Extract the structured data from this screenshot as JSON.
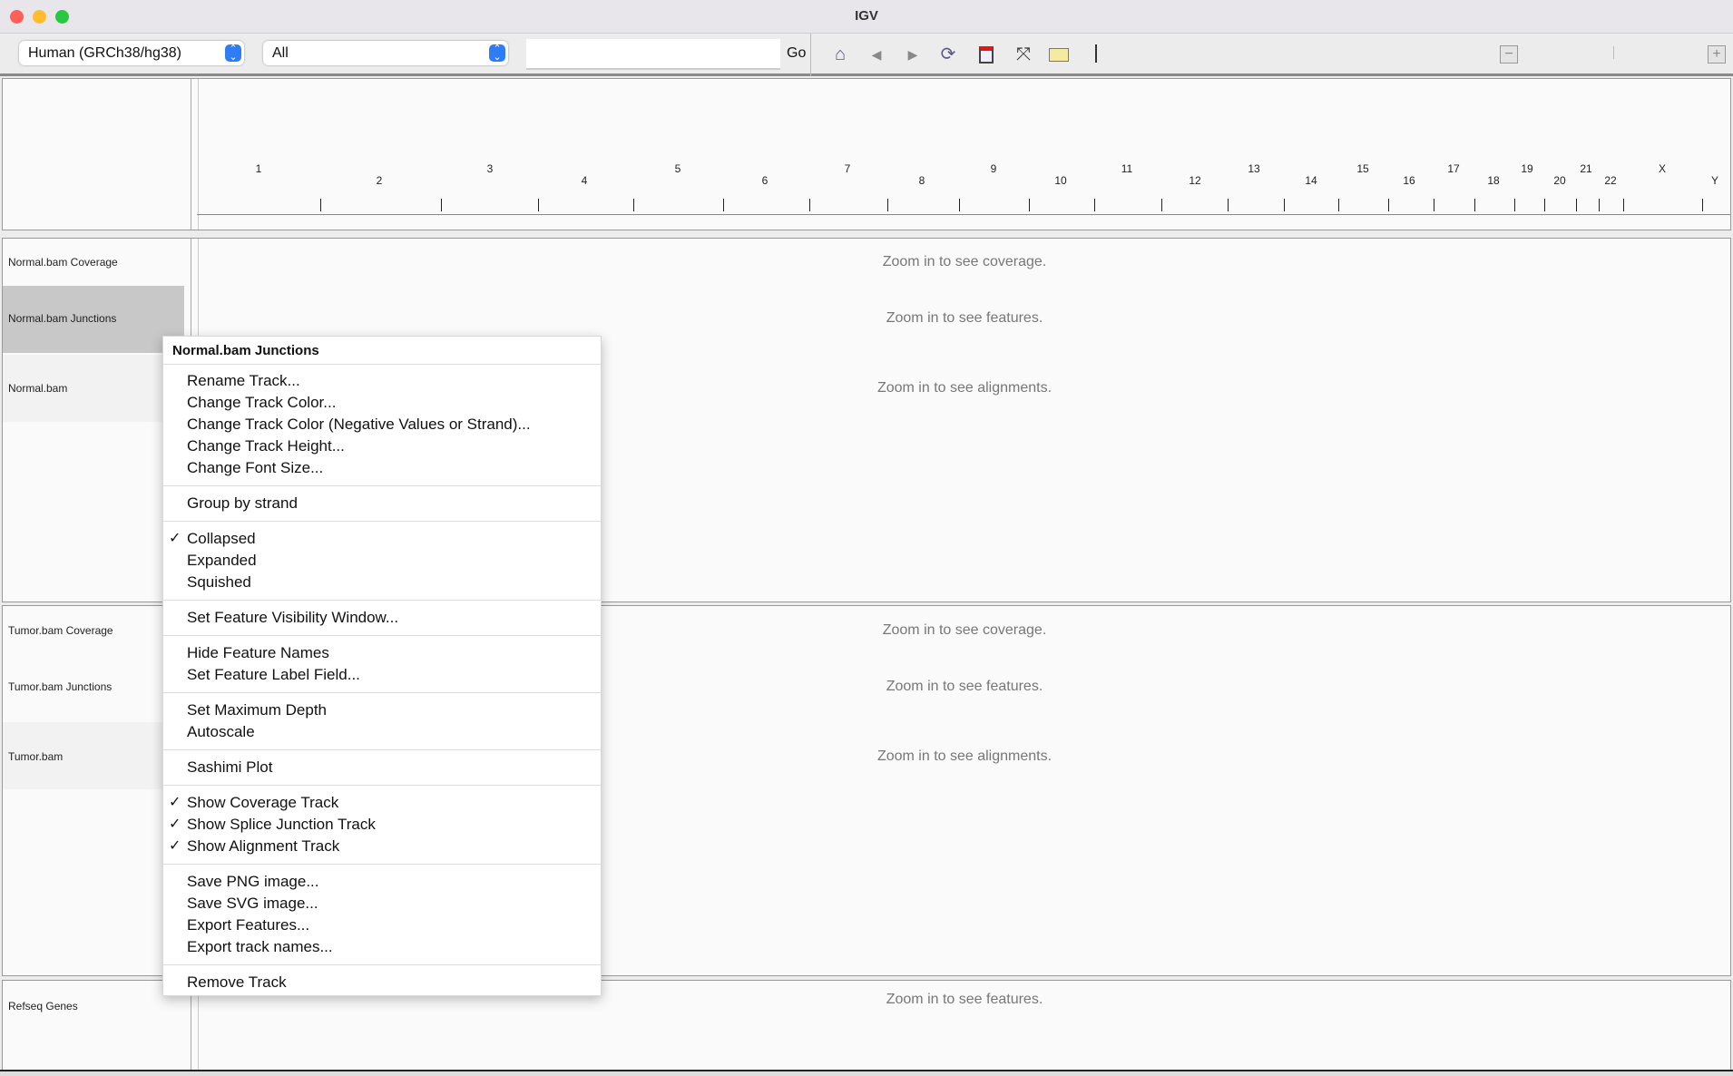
{
  "window": {
    "title": "IGV"
  },
  "toolbar": {
    "genome": "Human (GRCh38/hg38)",
    "chromosome": "All",
    "locus_value": "",
    "go_label": "Go"
  },
  "ruler": {
    "labels": [
      "1",
      "2",
      "3",
      "4",
      "5",
      "6",
      "7",
      "8",
      "9",
      "10",
      "11",
      "12",
      "13",
      "14",
      "15",
      "16",
      "17",
      "18",
      "19",
      "20",
      "21",
      "22",
      "X",
      "Y"
    ]
  },
  "tracks": {
    "normal_cov": {
      "name": "Normal.bam Coverage",
      "msg": "Zoom in to see coverage."
    },
    "normal_junc": {
      "name": "Normal.bam Junctions",
      "msg": "Zoom in to see features."
    },
    "normal_bam": {
      "name": "Normal.bam",
      "msg": "Zoom in to see alignments."
    },
    "tumor_cov": {
      "name": "Tumor.bam Coverage",
      "msg": "Zoom in to see coverage."
    },
    "tumor_junc": {
      "name": "Tumor.bam Junctions",
      "msg": "Zoom in to see features."
    },
    "tumor_bam": {
      "name": "Tumor.bam",
      "msg": "Zoom in to see alignments."
    },
    "refseq": {
      "name": "Refseq Genes",
      "msg": "Zoom in to see features."
    }
  },
  "menu": {
    "header": "Normal.bam Junctions",
    "groups": [
      [
        {
          "label": "Rename Track..."
        },
        {
          "label": "Change Track Color..."
        },
        {
          "label": "Change Track Color (Negative Values or Strand)..."
        },
        {
          "label": "Change Track Height..."
        },
        {
          "label": "Change Font Size..."
        }
      ],
      [
        {
          "label": "Group by strand"
        }
      ],
      [
        {
          "label": "Collapsed",
          "checked": true
        },
        {
          "label": "Expanded"
        },
        {
          "label": "Squished"
        }
      ],
      [
        {
          "label": "Set Feature Visibility Window..."
        }
      ],
      [
        {
          "label": "Hide Feature Names"
        },
        {
          "label": "Set Feature Label Field..."
        }
      ],
      [
        {
          "label": "Set Maximum Depth"
        },
        {
          "label": "Autoscale"
        }
      ],
      [
        {
          "label": "Sashimi Plot"
        }
      ],
      [
        {
          "label": "Show Coverage Track",
          "checked": true
        },
        {
          "label": "Show Splice Junction Track",
          "checked": true
        },
        {
          "label": "Show Alignment Track",
          "checked": true
        }
      ],
      [
        {
          "label": "Save PNG image..."
        },
        {
          "label": "Save SVG image..."
        },
        {
          "label": "Export Features..."
        },
        {
          "label": "Export track names..."
        }
      ],
      [
        {
          "label": "Remove Track"
        }
      ]
    ]
  },
  "colors": {
    "accent": "#2e7cf6",
    "selected_track": "#c8c8c8"
  }
}
